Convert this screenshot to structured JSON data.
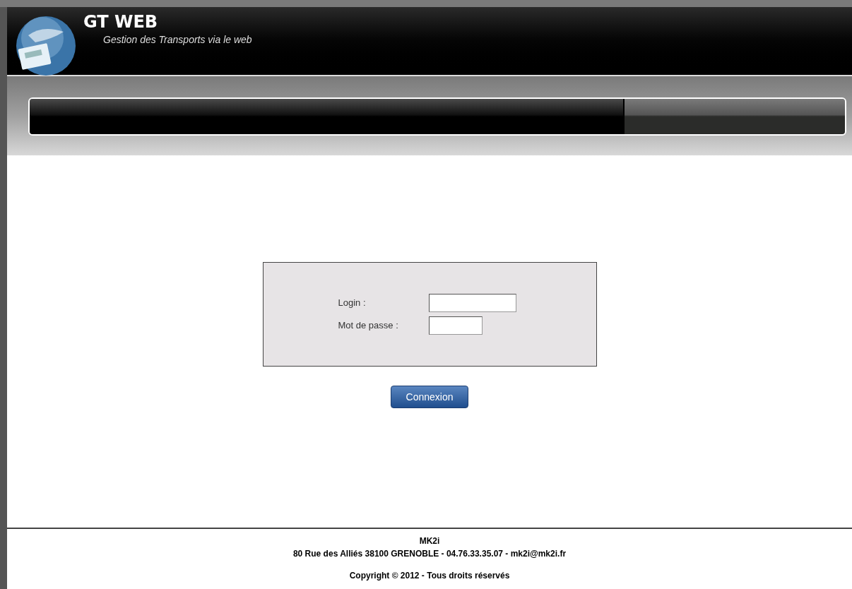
{
  "header": {
    "title": "GT WEB",
    "subtitle": "Gestion des Transports via le web"
  },
  "login_form": {
    "fields": [
      {
        "label": "Login :",
        "kind": "text"
      },
      {
        "label": "Mot de passe :",
        "kind": "password"
      }
    ],
    "button": "Connexion"
  },
  "footer": {
    "company": "MK2i",
    "address": "80 Rue des Alliés 38100 GRENOBLE - 04.76.33.35.07 - mk2i@mk2i.fr",
    "copyright": "Copyright © 2012 - Tous droits réservés"
  }
}
